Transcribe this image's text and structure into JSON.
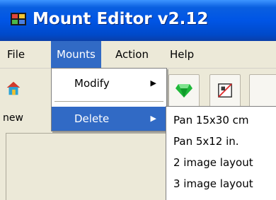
{
  "window": {
    "title": "Mount Editor v2.12"
  },
  "menubar": {
    "items": [
      "File",
      "Mounts",
      "Action",
      "Help"
    ]
  },
  "toolbar": {
    "new_label": "new"
  },
  "mounts_menu": {
    "items": [
      {
        "label": "Modify",
        "has_submenu": true
      },
      {
        "label": "Delete",
        "has_submenu": true,
        "highlighted": true
      }
    ]
  },
  "delete_submenu": {
    "items": [
      "Pan 15x30 cm",
      "Pan 5x12 in.",
      "2 image layout",
      "3 image layout"
    ]
  },
  "colors": {
    "titlebar": "#0055e5",
    "highlight": "#316ac5",
    "chrome": "#ece9d8"
  }
}
